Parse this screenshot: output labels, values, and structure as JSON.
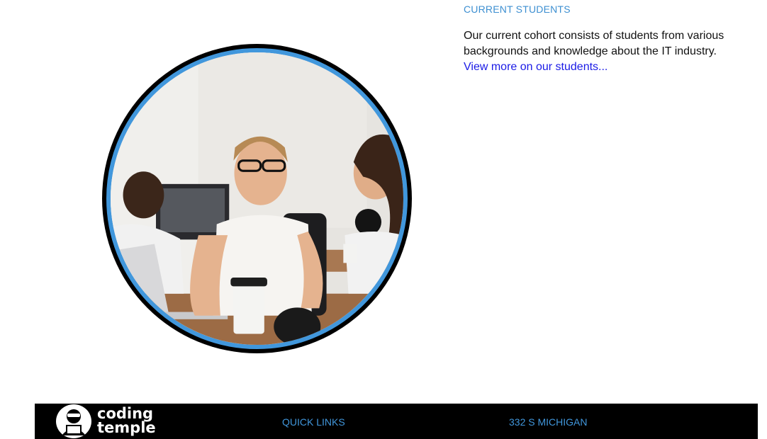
{
  "students_section": {
    "heading": "CURRENT STUDENTS",
    "body": "Our current cohort consists of students from various backgrounds and knowledge about the IT industry.",
    "link": "View more on our students..."
  },
  "photo": {
    "icon": "students-photo"
  },
  "footer": {
    "logo_line1": "coding",
    "logo_line2": "temple",
    "quick_links": "QUICK LINKS",
    "address": "332 S MICHIGAN"
  },
  "colors": {
    "accent": "#4197dc",
    "heading": "#3d8fd1",
    "link": "#1a1ae6",
    "footer_bg": "#000000"
  }
}
